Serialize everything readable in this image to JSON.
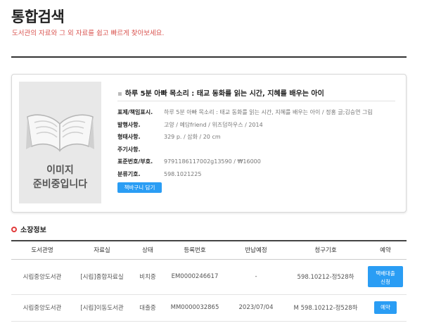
{
  "header": {
    "title": "통합검색",
    "subtitle": "도서관의 자료와 그 외 자료를 쉽고 빠르게 찾아보세요."
  },
  "book": {
    "cover_text_line1": "이미지",
    "cover_text_line2": "준비중입니다",
    "title_bullet": "▪",
    "title": "하루 5분 아빠 목소리 : 태교 동화를 읽는 시간, 지혜를 배우는 아이",
    "fields": [
      {
        "label": "표제/책임표시.",
        "value": "하루 5분 아빠 목소리 : 태교 동화를 읽는 시간, 지혜를 배우는 아이 / 정홍 글;김승연 그림"
      },
      {
        "label": "발행사항.",
        "value": "고양 / 예담friend / 위즈덤하우스 / 2014"
      },
      {
        "label": "형태사항.",
        "value": "329 p. / 삽화 / 20 cm"
      },
      {
        "label": "주기사항.",
        "value": ""
      },
      {
        "label": "표준번호/부호.",
        "value": "9791186117002g13590 / ₩16000"
      },
      {
        "label": "분류기호.",
        "value": "598.1021225"
      }
    ],
    "cart_button": "책바구니 담기"
  },
  "holdings": {
    "section_title": "소장정보",
    "columns": [
      "도서관명",
      "자료실",
      "상태",
      "등록번호",
      "반납예정",
      "청구기호",
      "예약"
    ],
    "rows": [
      {
        "library": "시립중앙도서관",
        "room": "[시립]종합자료실",
        "status": "비치중",
        "reg_no": "EM0000246617",
        "due": "-",
        "call_no": "598.10212-정528하",
        "action_line1": "택배대출",
        "action_line2": "신청"
      },
      {
        "library": "시립중앙도서관",
        "room": "[시립]이동도서관",
        "status": "대출중",
        "reg_no": "MM0000032865",
        "due": "2023/07/04",
        "call_no": "M 598.10212-정528하",
        "action": "예약"
      }
    ]
  },
  "colors": {
    "accent_blue": "#2a9df4",
    "subtitle_red": "#d9534f",
    "section_marker_red": "#e23b3b"
  },
  "icons": [
    "open-book-icon",
    "ring-bullet-icon"
  ]
}
